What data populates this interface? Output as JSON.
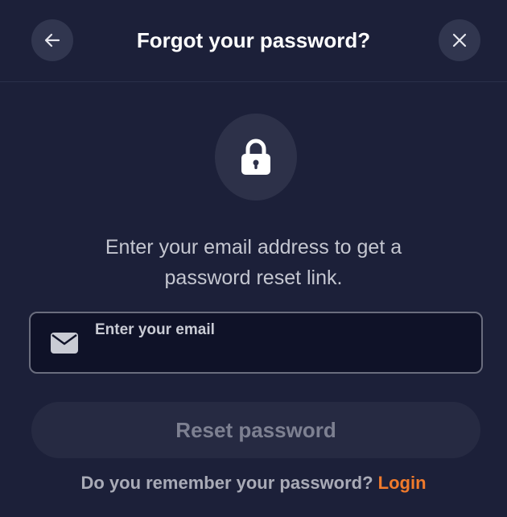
{
  "header": {
    "title": "Forgot your password?",
    "back_icon": "arrow-left-icon",
    "close_icon": "close-icon"
  },
  "hero": {
    "icon": "lock-icon"
  },
  "description": {
    "line1": "Enter your email address to get a",
    "line2": "password reset link."
  },
  "email": {
    "icon": "mail-icon",
    "placeholder": "Enter your email",
    "value": ""
  },
  "reset_button": {
    "label": "Reset password"
  },
  "footer": {
    "prompt": "Do you remember your password?",
    "link_label": "Login"
  },
  "colors": {
    "background": "#1c2039",
    "button_circle": "#31364f",
    "input_background": "#0f1228",
    "accent": "#f07a2b",
    "disabled_button": "#262a42"
  }
}
